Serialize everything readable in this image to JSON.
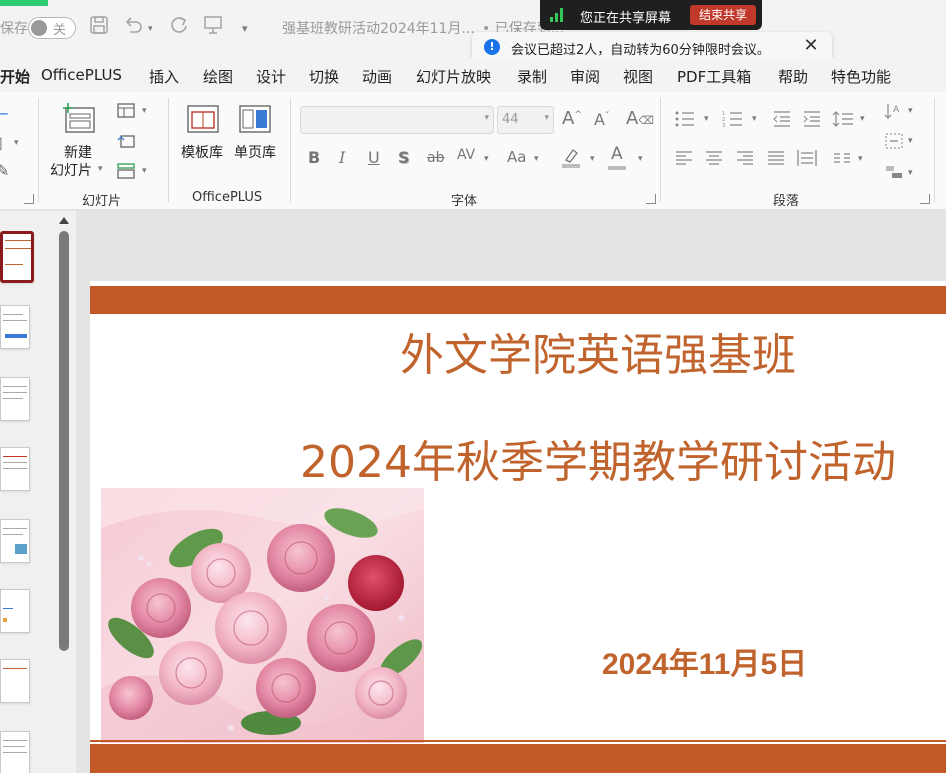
{
  "titlebar": {
    "autosave_label": "保存",
    "autosave_state": "关",
    "document_title": "强基班教研活动2024年11月...",
    "save_status": "• 已保存到...",
    "icons": [
      "save-icon",
      "undo-icon",
      "redo-icon",
      "present-icon",
      "customize-icon"
    ]
  },
  "sharing": {
    "status_text": "您正在共享屏幕",
    "end_button": "结束共享",
    "bars_color": "#34c759"
  },
  "notice": {
    "text": "会议已超过2人，自动转为60分钟限时会议。",
    "icon": "info-icon",
    "icon_glyph": "!",
    "close": "✕"
  },
  "menu": {
    "items": [
      "开始",
      "OfficePLUS",
      "插入",
      "绘图",
      "设计",
      "切换",
      "动画",
      "幻灯片放映",
      "录制",
      "审阅",
      "视图",
      "PDF工具箱",
      "帮助",
      "特色功能"
    ],
    "active_index": 0
  },
  "ribbon": {
    "slides_group": {
      "label": "幻灯片",
      "new_slide_line1": "新建",
      "new_slide_line2": "幻灯片"
    },
    "officeplus_group": {
      "label": "OfficePLUS",
      "template_library": "模板库",
      "single_page_library": "单页库"
    },
    "font_group": {
      "label": "字体",
      "font_name": "",
      "font_size": "44",
      "bold": "B",
      "italic": "I",
      "underline": "U",
      "shadow": "S",
      "strikethrough": "ab",
      "spacing": "AV",
      "change_case": "Aa",
      "font_color": "A",
      "font_color_value": "#c00000",
      "grow_font": "A",
      "shrink_font": "A"
    },
    "paragraph_group": {
      "label": "段落"
    }
  },
  "slide": {
    "title_line1": "外文学院英语强基班",
    "title_line2": "2024年秋季学期教学研讨活动",
    "date": "2024年11月5日",
    "accent_color": "#c25a28",
    "text_color": "#c0632c"
  },
  "thumbnails": {
    "count": 8,
    "selected_index": 0
  }
}
